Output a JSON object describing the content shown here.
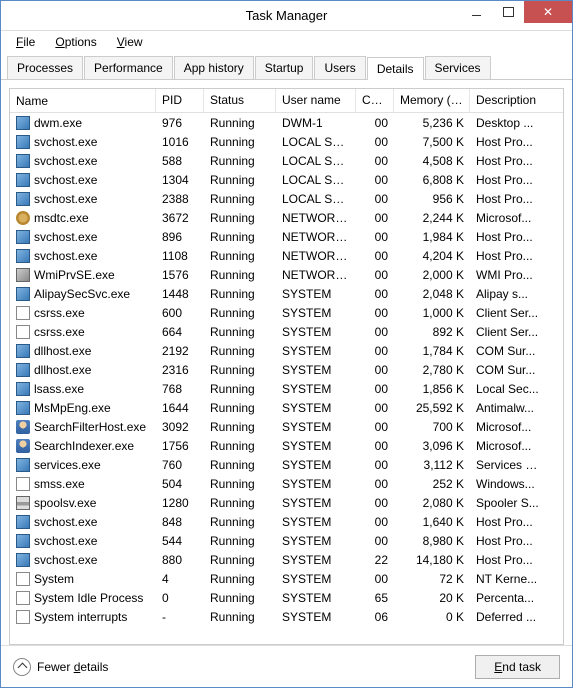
{
  "window": {
    "title": "Task Manager"
  },
  "menu": {
    "file": "File",
    "options": "Options",
    "view": "View"
  },
  "tabs": [
    {
      "label": "Processes"
    },
    {
      "label": "Performance"
    },
    {
      "label": "App history"
    },
    {
      "label": "Startup"
    },
    {
      "label": "Users"
    },
    {
      "label": "Details",
      "active": true
    },
    {
      "label": "Services"
    }
  ],
  "columns": {
    "name": "Name",
    "pid": "PID",
    "status": "Status",
    "user": "User name",
    "cpu": "CPU",
    "mem": "Memory (p...",
    "desc": "Description"
  },
  "rows": [
    {
      "icon": "app",
      "name": "dwm.exe",
      "pid": "976",
      "status": "Running",
      "user": "DWM-1",
      "cpu": "00",
      "mem": "5,236 K",
      "desc": "Desktop ..."
    },
    {
      "icon": "app",
      "name": "svchost.exe",
      "pid": "1016",
      "status": "Running",
      "user": "LOCAL SE...",
      "cpu": "00",
      "mem": "7,500 K",
      "desc": "Host Pro..."
    },
    {
      "icon": "app",
      "name": "svchost.exe",
      "pid": "588",
      "status": "Running",
      "user": "LOCAL SE...",
      "cpu": "00",
      "mem": "4,508 K",
      "desc": "Host Pro..."
    },
    {
      "icon": "app",
      "name": "svchost.exe",
      "pid": "1304",
      "status": "Running",
      "user": "LOCAL SE...",
      "cpu": "00",
      "mem": "6,808 K",
      "desc": "Host Pro..."
    },
    {
      "icon": "app",
      "name": "svchost.exe",
      "pid": "2388",
      "status": "Running",
      "user": "LOCAL SE...",
      "cpu": "00",
      "mem": "956 K",
      "desc": "Host Pro..."
    },
    {
      "icon": "gear",
      "name": "msdtc.exe",
      "pid": "3672",
      "status": "Running",
      "user": "NETWORK...",
      "cpu": "00",
      "mem": "2,244 K",
      "desc": "Microsof..."
    },
    {
      "icon": "app",
      "name": "svchost.exe",
      "pid": "896",
      "status": "Running",
      "user": "NETWORK...",
      "cpu": "00",
      "mem": "1,984 K",
      "desc": "Host Pro..."
    },
    {
      "icon": "app",
      "name": "svchost.exe",
      "pid": "1108",
      "status": "Running",
      "user": "NETWORK...",
      "cpu": "00",
      "mem": "4,204 K",
      "desc": "Host Pro..."
    },
    {
      "icon": "svc",
      "name": "WmiPrvSE.exe",
      "pid": "1576",
      "status": "Running",
      "user": "NETWORK...",
      "cpu": "00",
      "mem": "2,000 K",
      "desc": "WMI Pro..."
    },
    {
      "icon": "app",
      "name": "AlipaySecSvc.exe",
      "pid": "1448",
      "status": "Running",
      "user": "SYSTEM",
      "cpu": "00",
      "mem": "2,048 K",
      "desc": "Alipay s..."
    },
    {
      "icon": "sys",
      "name": "csrss.exe",
      "pid": "600",
      "status": "Running",
      "user": "SYSTEM",
      "cpu": "00",
      "mem": "1,000 K",
      "desc": "Client Ser..."
    },
    {
      "icon": "sys",
      "name": "csrss.exe",
      "pid": "664",
      "status": "Running",
      "user": "SYSTEM",
      "cpu": "00",
      "mem": "892 K",
      "desc": "Client Ser..."
    },
    {
      "icon": "app",
      "name": "dllhost.exe",
      "pid": "2192",
      "status": "Running",
      "user": "SYSTEM",
      "cpu": "00",
      "mem": "1,784 K",
      "desc": "COM Sur..."
    },
    {
      "icon": "app",
      "name": "dllhost.exe",
      "pid": "2316",
      "status": "Running",
      "user": "SYSTEM",
      "cpu": "00",
      "mem": "2,780 K",
      "desc": "COM Sur..."
    },
    {
      "icon": "app",
      "name": "lsass.exe",
      "pid": "768",
      "status": "Running",
      "user": "SYSTEM",
      "cpu": "00",
      "mem": "1,856 K",
      "desc": "Local Sec..."
    },
    {
      "icon": "app",
      "name": "MsMpEng.exe",
      "pid": "1644",
      "status": "Running",
      "user": "SYSTEM",
      "cpu": "00",
      "mem": "25,592 K",
      "desc": "Antimalw..."
    },
    {
      "icon": "user",
      "name": "SearchFilterHost.exe",
      "pid": "3092",
      "status": "Running",
      "user": "SYSTEM",
      "cpu": "00",
      "mem": "700 K",
      "desc": "Microsof..."
    },
    {
      "icon": "user",
      "name": "SearchIndexer.exe",
      "pid": "1756",
      "status": "Running",
      "user": "SYSTEM",
      "cpu": "00",
      "mem": "3,096 K",
      "desc": "Microsof..."
    },
    {
      "icon": "app",
      "name": "services.exe",
      "pid": "760",
      "status": "Running",
      "user": "SYSTEM",
      "cpu": "00",
      "mem": "3,112 K",
      "desc": "Services a..."
    },
    {
      "icon": "sys",
      "name": "smss.exe",
      "pid": "504",
      "status": "Running",
      "user": "SYSTEM",
      "cpu": "00",
      "mem": "252 K",
      "desc": "Windows..."
    },
    {
      "icon": "print",
      "name": "spoolsv.exe",
      "pid": "1280",
      "status": "Running",
      "user": "SYSTEM",
      "cpu": "00",
      "mem": "2,080 K",
      "desc": "Spooler S..."
    },
    {
      "icon": "app",
      "name": "svchost.exe",
      "pid": "848",
      "status": "Running",
      "user": "SYSTEM",
      "cpu": "00",
      "mem": "1,640 K",
      "desc": "Host Pro..."
    },
    {
      "icon": "app",
      "name": "svchost.exe",
      "pid": "544",
      "status": "Running",
      "user": "SYSTEM",
      "cpu": "00",
      "mem": "8,980 K",
      "desc": "Host Pro..."
    },
    {
      "icon": "app",
      "name": "svchost.exe",
      "pid": "880",
      "status": "Running",
      "user": "SYSTEM",
      "cpu": "22",
      "mem": "14,180 K",
      "desc": "Host Pro..."
    },
    {
      "icon": "sys",
      "name": "System",
      "pid": "4",
      "status": "Running",
      "user": "SYSTEM",
      "cpu": "00",
      "mem": "72 K",
      "desc": "NT Kerne..."
    },
    {
      "icon": "sys",
      "name": "System Idle Process",
      "pid": "0",
      "status": "Running",
      "user": "SYSTEM",
      "cpu": "65",
      "mem": "20 K",
      "desc": "Percenta..."
    },
    {
      "icon": "sys",
      "name": "System interrupts",
      "pid": "-",
      "status": "Running",
      "user": "SYSTEM",
      "cpu": "06",
      "mem": "0 K",
      "desc": "Deferred ..."
    }
  ],
  "footer": {
    "fewer": "Fewer details",
    "endtask": "End task"
  }
}
